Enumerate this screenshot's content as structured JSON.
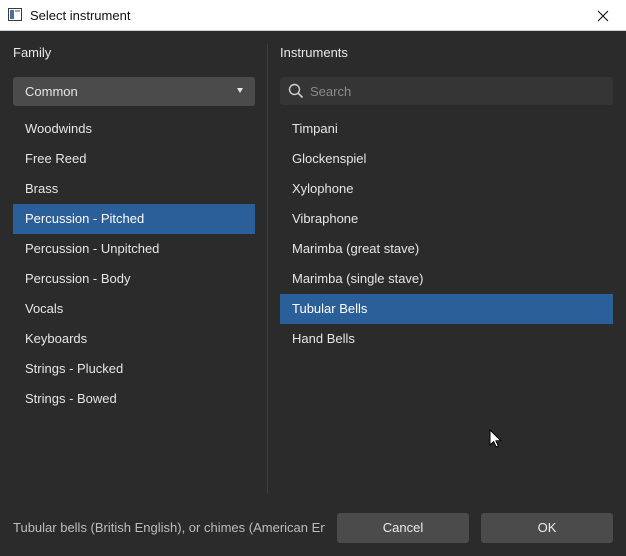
{
  "window": {
    "title": "Select instrument",
    "icon": "app-window-icon",
    "close_icon": "close-icon"
  },
  "family": {
    "heading": "Family",
    "dropdown_value": "Common",
    "items": [
      {
        "label": "Woodwinds",
        "selected": false
      },
      {
        "label": "Free Reed",
        "selected": false
      },
      {
        "label": "Brass",
        "selected": false
      },
      {
        "label": "Percussion - Pitched",
        "selected": true
      },
      {
        "label": "Percussion - Unpitched",
        "selected": false
      },
      {
        "label": "Percussion - Body",
        "selected": false
      },
      {
        "label": "Vocals",
        "selected": false
      },
      {
        "label": "Keyboards",
        "selected": false
      },
      {
        "label": "Strings - Plucked",
        "selected": false
      },
      {
        "label": "Strings - Bowed",
        "selected": false
      }
    ]
  },
  "instruments": {
    "heading": "Instruments",
    "search_placeholder": "Search",
    "search_value": "",
    "items": [
      {
        "label": "Timpani",
        "selected": false
      },
      {
        "label": "Glockenspiel",
        "selected": false
      },
      {
        "label": "Xylophone",
        "selected": false
      },
      {
        "label": "Vibraphone",
        "selected": false
      },
      {
        "label": "Marimba (great stave)",
        "selected": false
      },
      {
        "label": "Marimba (single stave)",
        "selected": false
      },
      {
        "label": "Tubular Bells",
        "selected": true
      },
      {
        "label": "Hand Bells",
        "selected": false
      }
    ]
  },
  "footer": {
    "description": "Tubular bells (British English), or chimes (American Englis...",
    "cancel_label": "Cancel",
    "ok_label": "OK"
  },
  "colors": {
    "background": "#2b2b2b",
    "selection": "#2a5f99",
    "button": "#4b4b4b"
  }
}
